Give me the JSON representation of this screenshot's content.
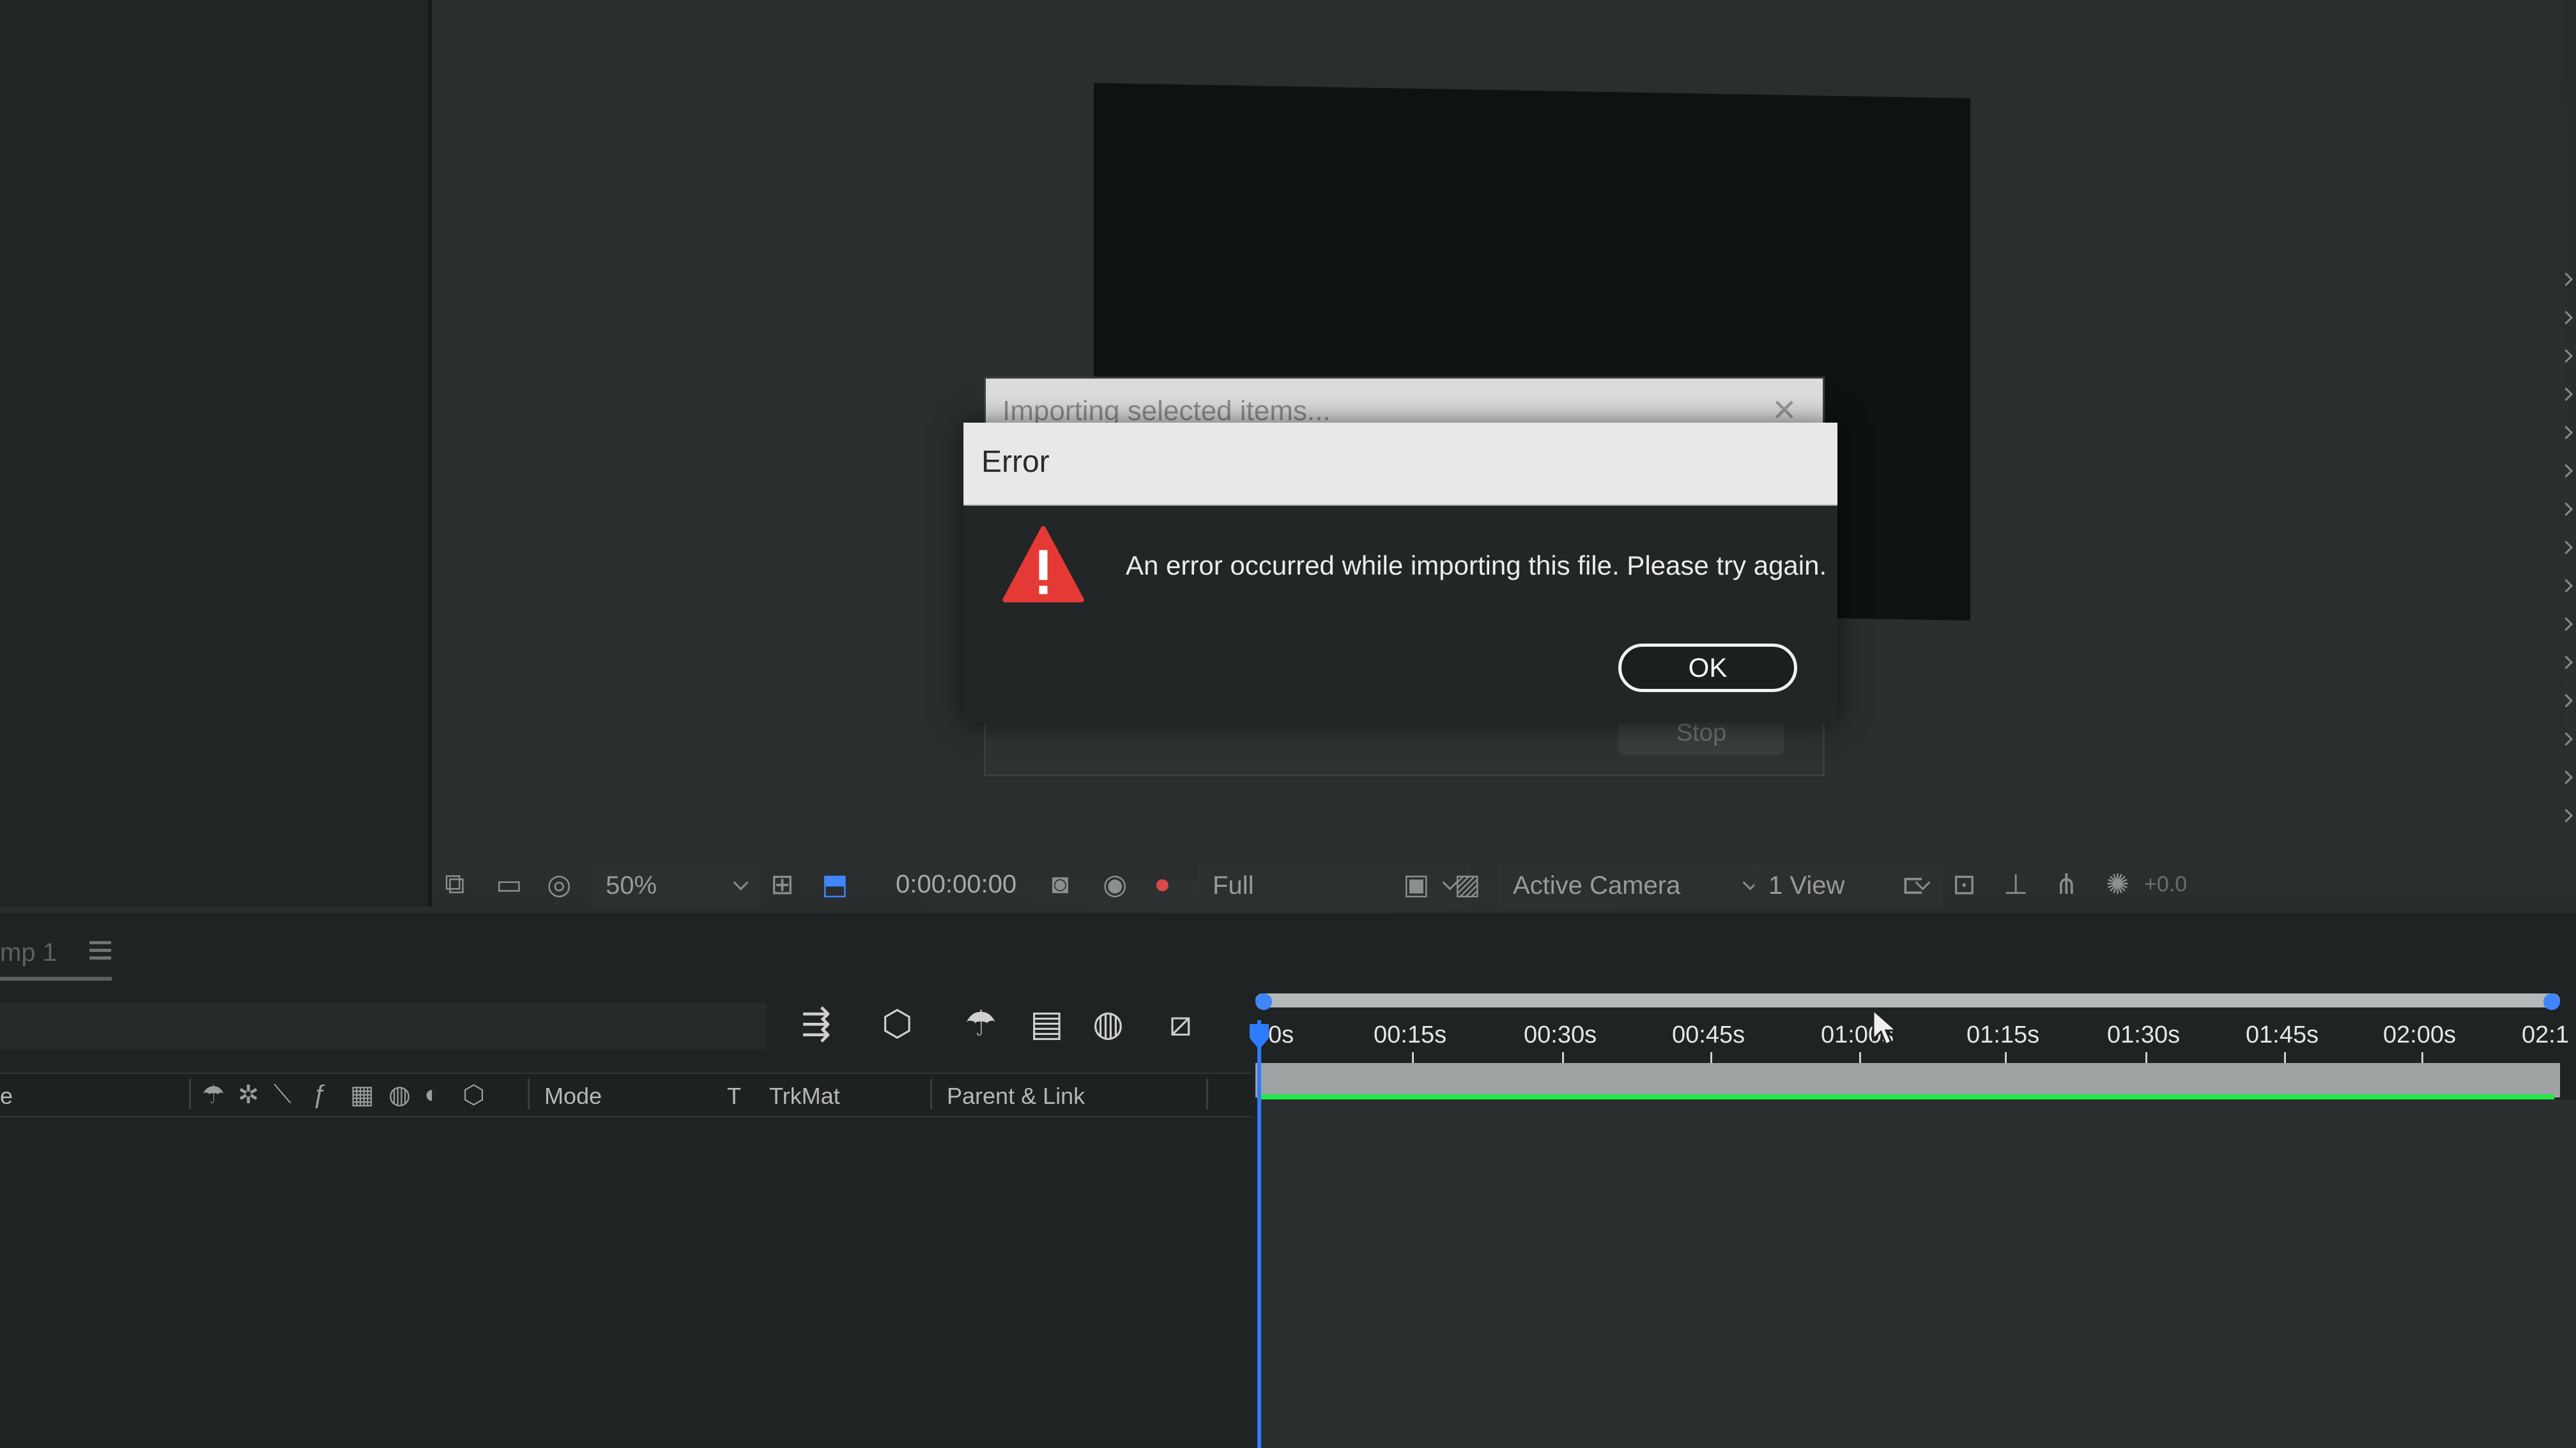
{
  "viewer_toolbar": {
    "magnification": "50%",
    "timecode": "0:00:00:00",
    "resolution": "Full",
    "camera": "Active Camera",
    "views": "1 View",
    "exposure": "+0.0"
  },
  "timeline": {
    "comp_tab": "mp 1",
    "columns": {
      "left_cut": "e",
      "mode": "Mode",
      "t": "T",
      "trkmat": "TrkMat",
      "parent": "Parent & Link"
    },
    "ruler_labels": [
      "0s",
      "00:15s",
      "00:30s",
      "00:45s",
      "01:00s",
      "01:15s",
      "01:30s",
      "01:45s",
      "02:00s",
      "02:1"
    ]
  },
  "importing_dialog": {
    "title": "Importing selected items...",
    "stop_label": "Stop"
  },
  "error_dialog": {
    "title": "Error",
    "message": "An error occurred while importing this file. Please try again.",
    "ok_label": "OK"
  },
  "colors": {
    "accent_blue": "#2d7cff",
    "warning_red": "#e53935",
    "progress_green": "#22e84a"
  }
}
